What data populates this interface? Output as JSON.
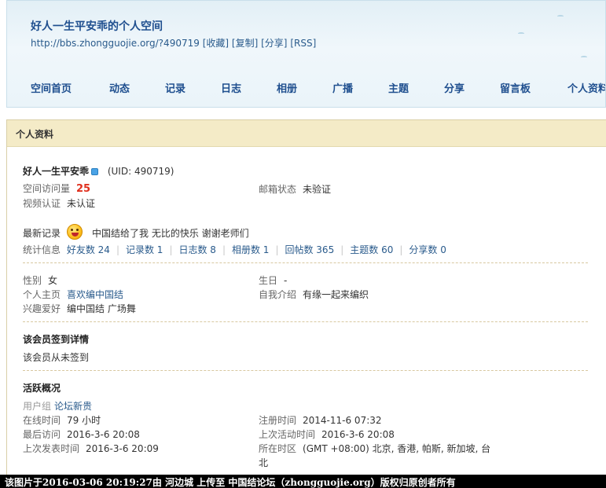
{
  "header": {
    "title": "好人一生平安乖的个人空间",
    "url": "http://bbs.zhongguojie.org/?490719",
    "links": [
      "[收藏]",
      "[复制]",
      "[分享]",
      "[RSS]"
    ],
    "nav": [
      "空间首页",
      "动态",
      "记录",
      "日志",
      "相册",
      "广播",
      "主题",
      "分享",
      "留言板",
      "个人资料"
    ]
  },
  "profile": {
    "box_title": "个人资料",
    "username": "好人一生平安乖",
    "uid": "(UID: 490719)",
    "visits_label": "空间访问量",
    "visits": "25",
    "email_label": "邮箱状态",
    "email_value": "未验证",
    "video_label": "视频认证",
    "video_value": "未认证",
    "latest_label": "最新记录",
    "latest_text": "中国结给了我 无比的快乐  谢谢老师们",
    "stats_label": "统计信息",
    "stats": [
      "好友数 24",
      "记录数 1",
      "日志数 8",
      "相册数 1",
      "回帖数 365",
      "主题数 60",
      "分享数 0"
    ],
    "gender_label": "性别",
    "gender_value": "女",
    "birthday_label": "生日",
    "birthday_value": "-",
    "homepage_label": "个人主页",
    "homepage_value": "喜欢编中国结",
    "intro_label": "自我介绍",
    "intro_value": "有缘一起来编织",
    "hobby_label": "兴趣爱好",
    "hobby_value": "编中国结 广场舞"
  },
  "signin": {
    "title": "该会员签到详情",
    "text": "该会员从未签到"
  },
  "activity": {
    "title": "活跃概况",
    "group_label": "用户组",
    "group_value": "论坛新贵",
    "online_label": "在线时间",
    "online_value": "79 小时",
    "reg_label": "注册时间",
    "reg_value": "2014-11-6 07:32",
    "last_visit_label": "最后访问",
    "last_visit_value": "2016-3-6 20:08",
    "last_active_label": "上次活动时间",
    "last_active_value": "2016-3-6 20:08",
    "last_post_label": "上次发表时间",
    "last_post_value": "2016-3-6 20:09",
    "timezone_label": "所在时区",
    "timezone_value_1": "(GMT +08:00) 北京, 香港, 帕斯, 新加坡, 台",
    "timezone_value_2": "北"
  },
  "footer": {
    "text": "该图片于2016-03-06  20:19:27由  河边城  上传至  中国结论坛（zhongguojie.org）版权归原创者所有"
  }
}
